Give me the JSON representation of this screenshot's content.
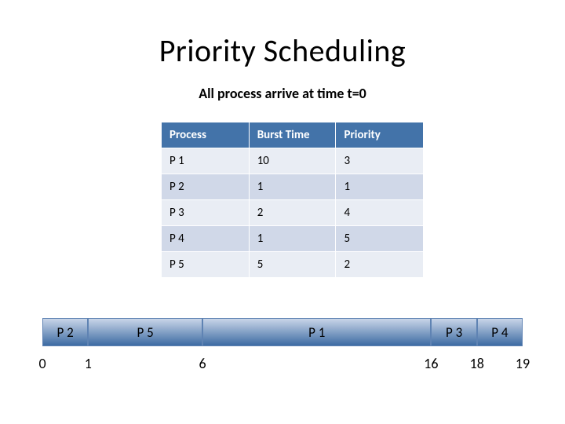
{
  "title": "Priority Scheduling",
  "subtitle": "All process arrive at time t=0",
  "table": {
    "headers": {
      "process": "Process",
      "burst": "Burst Time",
      "priority": "Priority"
    },
    "rows": [
      {
        "process": "P 1",
        "burst": "10",
        "priority": "3"
      },
      {
        "process": "P 2",
        "burst": "1",
        "priority": "1"
      },
      {
        "process": "P 3",
        "burst": "2",
        "priority": "4"
      },
      {
        "process": "P 4",
        "burst": "1",
        "priority": "5"
      },
      {
        "process": "P 5",
        "burst": "5",
        "priority": "2"
      }
    ]
  },
  "gantt": {
    "segments": [
      {
        "label": "P 2",
        "start": 0,
        "end": 1
      },
      {
        "label": "P 5",
        "start": 1,
        "end": 6
      },
      {
        "label": "P 1",
        "start": 6,
        "end": 16
      },
      {
        "label": "P 3",
        "start": 16,
        "end": 18
      },
      {
        "label": "P 4",
        "start": 18,
        "end": 19
      }
    ],
    "ticks": [
      {
        "t": 0,
        "label": "0"
      },
      {
        "t": 1,
        "label": "1"
      },
      {
        "t": 6,
        "label": "6"
      },
      {
        "t": 16,
        "label": "16"
      },
      {
        "t": 18,
        "label": "18"
      },
      {
        "t": 19,
        "label": "19"
      }
    ]
  },
  "chart_data": {
    "type": "table",
    "title": "Priority Scheduling",
    "columns": [
      "Process",
      "Burst Time",
      "Priority"
    ],
    "rows": [
      [
        "P 1",
        10,
        3
      ],
      [
        "P 2",
        1,
        1
      ],
      [
        "P 3",
        2,
        4
      ],
      [
        "P 4",
        1,
        5
      ],
      [
        "P 5",
        5,
        2
      ]
    ],
    "gantt": {
      "sequence": [
        {
          "process": "P 2",
          "start": 0,
          "end": 1
        },
        {
          "process": "P 5",
          "start": 1,
          "end": 6
        },
        {
          "process": "P 1",
          "start": 6,
          "end": 16
        },
        {
          "process": "P 3",
          "start": 16,
          "end": 18
        },
        {
          "process": "P 4",
          "start": 18,
          "end": 19
        }
      ],
      "axis_ticks": [
        0,
        1,
        6,
        16,
        18,
        19
      ]
    }
  }
}
